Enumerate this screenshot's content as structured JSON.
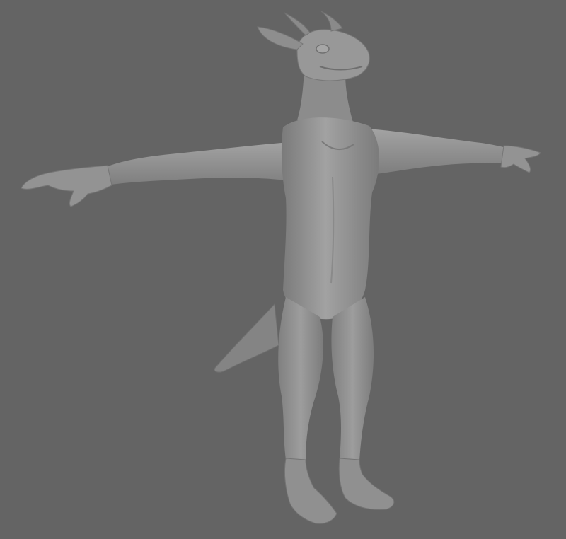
{
  "viewport": {
    "background_color": "#646464",
    "subject": "dragon-character-t-pose",
    "material_color": "#8f8f8f",
    "material_highlight": "#a9a9a9",
    "material_shadow": "#6b6b6b"
  }
}
